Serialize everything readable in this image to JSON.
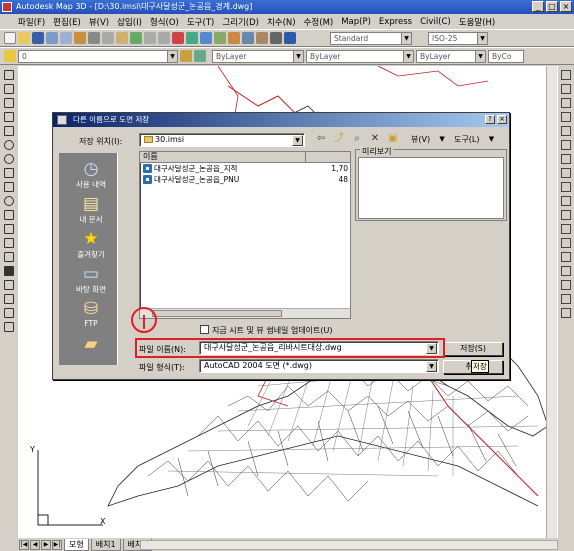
{
  "window": {
    "title": "Autodesk Map 3D - [D:\\30.imsi\\대구사달성군_논공읍_경계.dwg]",
    "buttons": [
      "_",
      "□",
      "×"
    ]
  },
  "menu": [
    "파일(F)",
    "편집(E)",
    "뷰(V)",
    "삽입(I)",
    "형식(O)",
    "도구(T)",
    "그리기(D)",
    "치수(N)",
    "수정(M)",
    "Map(P)",
    "Express",
    "Civil(C)",
    "도움말(H)"
  ],
  "toolbar": {
    "text_style": "Standard",
    "dim_style": "ISO-25",
    "layer": "0",
    "color": "ByLayer",
    "linetype": "ByLayer",
    "lineweight": "ByLayer",
    "plotstyle": "ByCo"
  },
  "dialog": {
    "title": "다른 이름으로 도면 저장",
    "help_btn": "?",
    "close_btn": "×",
    "save_in_label": "저장 위치(I):",
    "save_in_value": "30.imsi",
    "views_label": "뷰(V)",
    "tools_label": "도구(L)",
    "places": [
      {
        "label": "사용 내역",
        "icon": "history-icon"
      },
      {
        "label": "내 문서",
        "icon": "my-documents-icon"
      },
      {
        "label": "즐겨찾기",
        "icon": "favorites-icon"
      },
      {
        "label": "바탕 화면",
        "icon": "desktop-icon"
      },
      {
        "label": "FTP",
        "icon": "ftp-icon"
      },
      {
        "label": "",
        "icon": "folder-icon"
      }
    ],
    "list_header": {
      "name": "이름",
      "size": ""
    },
    "files": [
      {
        "name": "대구사달성군_논공읍_지적",
        "size": "1,70"
      },
      {
        "name": "대구사달성군_논공읍_PNU",
        "size": "48"
      }
    ],
    "preview_label": "미리보기",
    "update_checkbox_label": "지금 시트 및 뷰 썸네일 업데이트(U)",
    "filename_label": "파일 이름(N):",
    "filename_value": "대구사달성군_논공읍_리바시트대상.dwg",
    "filetype_label": "파일 형식(T):",
    "filetype_value": "AutoCAD 2004 도면 (*.dwg)",
    "save_button": "저장(S)",
    "cancel_button": "취소",
    "tooltip": "저장"
  },
  "tabs": [
    "모형",
    "배치1",
    "배치2"
  ],
  "ucs": {
    "x": "X",
    "y": "Y"
  },
  "colors": {
    "title_bar": "#2450b8",
    "dialog_title": "#0a246a",
    "highlight": "#e02020"
  }
}
